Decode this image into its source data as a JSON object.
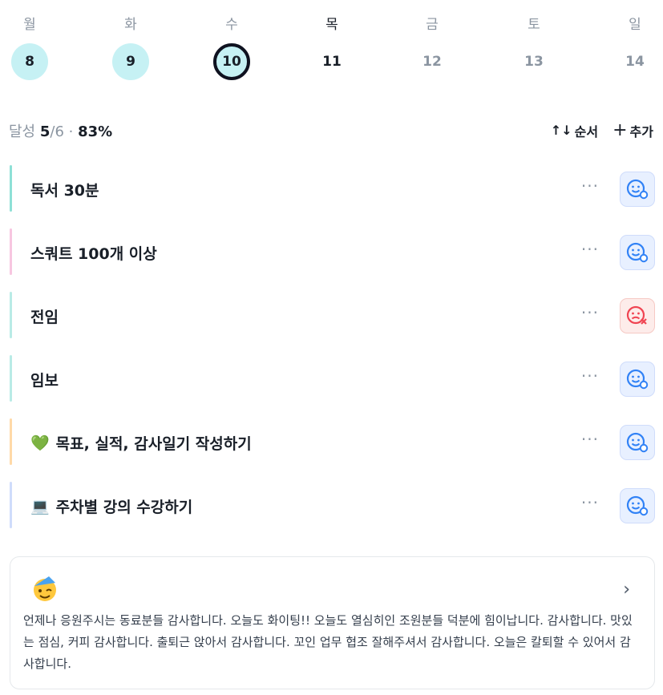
{
  "week": [
    {
      "dow": "월",
      "date": "8",
      "state": "done"
    },
    {
      "dow": "화",
      "date": "9",
      "state": "done"
    },
    {
      "dow": "수",
      "date": "10",
      "state": "today"
    },
    {
      "dow": "목",
      "date": "11",
      "state": "next"
    },
    {
      "dow": "금",
      "date": "12",
      "state": "future"
    },
    {
      "dow": "토",
      "date": "13",
      "state": "future"
    },
    {
      "dow": "일",
      "date": "14",
      "state": "future"
    }
  ],
  "summary": {
    "label": "달성",
    "done": "5",
    "total": "/6",
    "sep": "·",
    "percent": "83%"
  },
  "actions": {
    "sort_label": "순서",
    "sort_icon": "↑↓",
    "add_label": "추가",
    "add_icon": "+"
  },
  "habits": [
    {
      "emoji": "",
      "name": "독서 30분",
      "color": "#8ee0d6",
      "mood": "success"
    },
    {
      "emoji": "",
      "name": "스쿼트 100개 이상",
      "color": "#f7c6e0",
      "mood": "success"
    },
    {
      "emoji": "",
      "name": "전임",
      "color": "#b9ebe6",
      "mood": "fail"
    },
    {
      "emoji": "",
      "name": "임보",
      "color": "#b9ebe6",
      "mood": "success"
    },
    {
      "emoji": "💚",
      "name": "목표, 실적, 감사일기 작성하기",
      "color": "#ffd9a8",
      "mood": "success"
    },
    {
      "emoji": "💻",
      "name": "주차별 강의 수강하기",
      "color": "#cfdcfb",
      "mood": "success"
    }
  ],
  "more_label": "···",
  "note": {
    "emoji": "🥳",
    "chevron": "›",
    "text": "언제나 응원주시는 동료분들 감사합니다. 오늘도 화이팅!! 오늘도 열심히인 조원분들 덕분에 힘이납니다. 감사합니다. 맛있는 점심, 커피 감사합니다. 출퇴근 앉아서 감사합니다. 꼬인 업무 협조 잘해주셔서 감사합니다. 오늘은 칼퇴할 수 있어서 감사합니다."
  },
  "colors": {
    "accent": "#3182f6",
    "fail": "#f04452",
    "done_bg": "#c6f1f4"
  }
}
